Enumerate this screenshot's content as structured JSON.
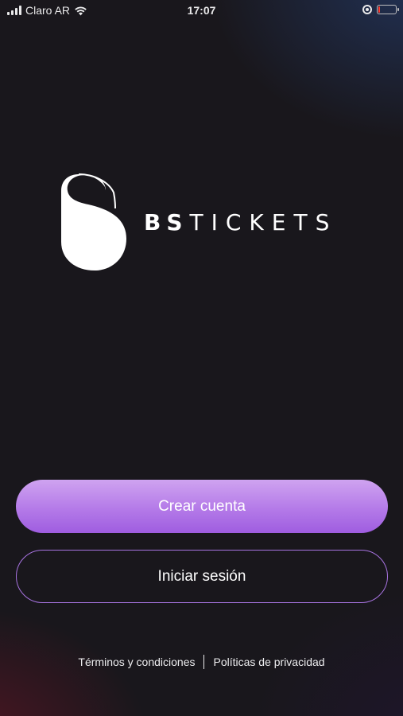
{
  "status_bar": {
    "carrier": "Claro AR",
    "time": "17:07",
    "icons": [
      "signal-icon",
      "wifi-icon",
      "orientation-lock-icon",
      "battery-icon"
    ],
    "battery_level": 0.1
  },
  "brand": {
    "wordmark_bold": "BS",
    "wordmark_light": "TICKETS",
    "logo_icon": "bs-logo-mark"
  },
  "actions": {
    "create_account": "Crear cuenta",
    "sign_in": "Iniciar sesión"
  },
  "footer": {
    "terms": "Términos y condiciones",
    "privacy": "Políticas de privacidad"
  },
  "colors": {
    "background": "#19171c",
    "primary_button": "#b47ae8",
    "secondary_border": "#a773e0",
    "battery_low": "#ff3b30"
  }
}
